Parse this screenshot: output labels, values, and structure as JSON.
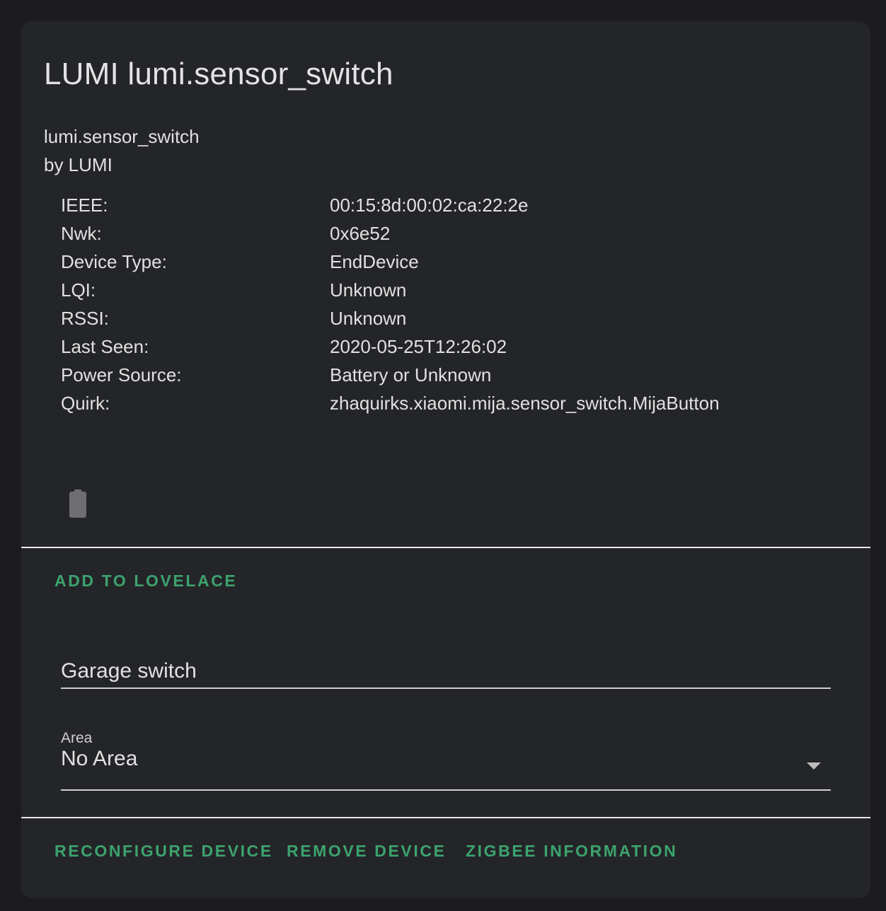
{
  "device": {
    "title": "LUMI lumi.sensor_switch",
    "model": "lumi.sensor_switch",
    "manufacturer_line": "by LUMI"
  },
  "details": [
    {
      "key": "IEEE:",
      "value": "00:15:8d:00:02:ca:22:2e"
    },
    {
      "key": "Nwk:",
      "value": "0x6e52"
    },
    {
      "key": "Device Type:",
      "value": "EndDevice"
    },
    {
      "key": "LQI:",
      "value": "Unknown"
    },
    {
      "key": "RSSI:",
      "value": "Unknown"
    },
    {
      "key": "Last Seen:",
      "value": "2020-05-25T12:26:02"
    },
    {
      "key": "Power Source:",
      "value": "Battery or Unknown"
    },
    {
      "key": "Quirk:",
      "value": "zhaquirks.xiaomi.mija.sensor_switch.MijaButton"
    }
  ],
  "battery": {
    "icon": "battery-unknown-icon",
    "color": "#6f6f72"
  },
  "actions": {
    "add_to_lovelace": "ADD TO LOVELACE",
    "reconfigure": "RECONFIGURE DEVICE",
    "remove": "REMOVE DEVICE",
    "zigbee_info": "ZIGBEE INFORMATION"
  },
  "name_field": {
    "value": "Garage switch"
  },
  "area_field": {
    "label": "Area",
    "value": "No Area"
  },
  "colors": {
    "accent": "#3ca36e",
    "card_bg": "#242528",
    "page_bg": "#1c1c1e"
  }
}
